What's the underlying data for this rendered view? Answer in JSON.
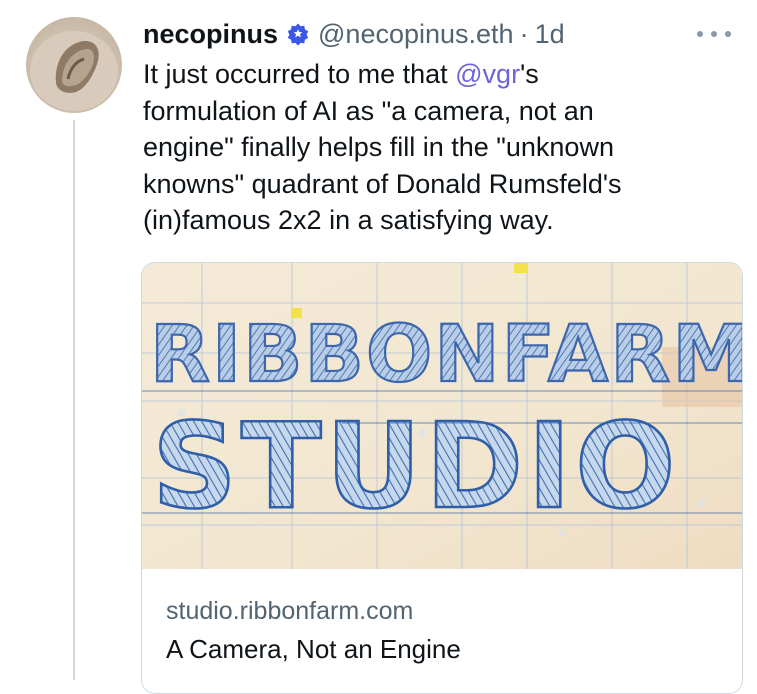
{
  "tweet": {
    "display_name": "necopinus",
    "handle": "@necopinus.eth",
    "separator": "·",
    "time": "1d",
    "text_parts": {
      "before": "It just occurred to me that ",
      "mention": "@vgr",
      "after": "'s\nformulation of AI as \"a camera, not an\nengine\" finally helps fill in the \"unknown\nknowns\" quadrant of Donald Rumsfeld's\n(in)famous 2x2 in a satisfying way."
    }
  },
  "card": {
    "image_line1": "RIBBONFARM",
    "image_line2": "STUDIO",
    "domain": "studio.ribbonfarm.com",
    "title": "A Camera, Not an Engine"
  },
  "icons": {
    "verified": "verified-badge-icon",
    "more": "more-options-icon",
    "avatar": "avatar"
  },
  "colors": {
    "text": "#0f1419",
    "muted": "#536471",
    "mention": "#6f63d9",
    "verified": "#3b57e8",
    "card_border": "#cfd9de"
  }
}
